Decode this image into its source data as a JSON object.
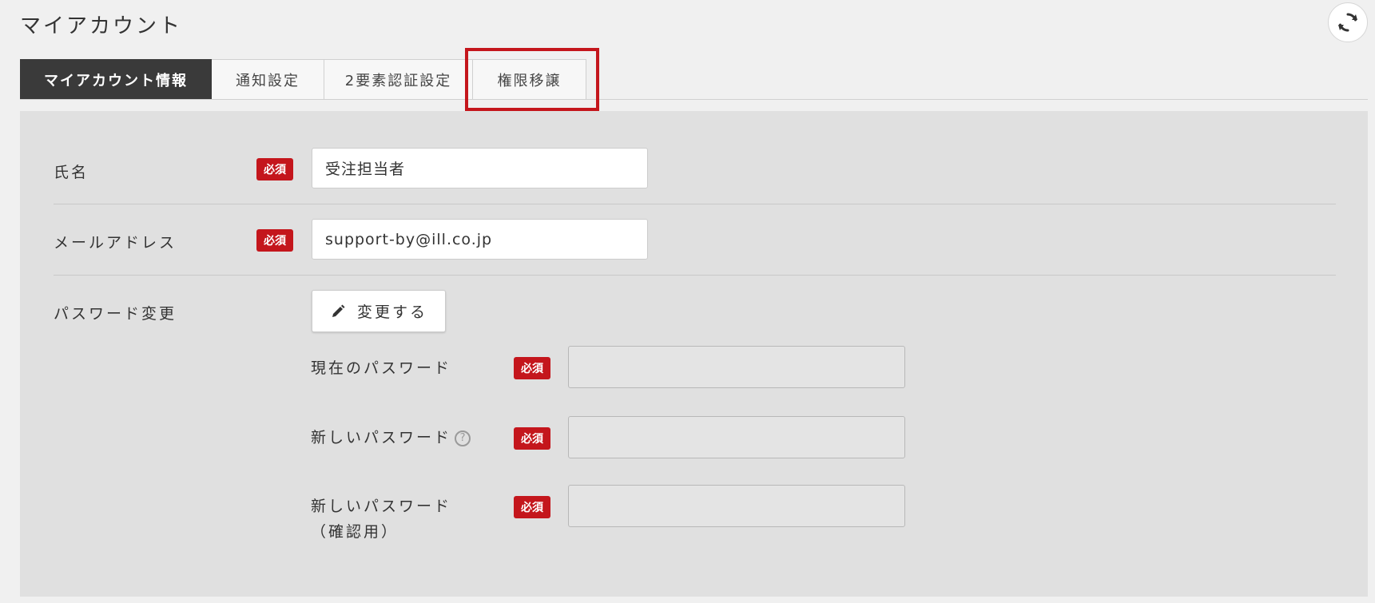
{
  "header": {
    "title": "マイアカウント",
    "refresh_icon": "refresh-icon"
  },
  "tabs": [
    {
      "label": "マイアカウント情報",
      "active": true
    },
    {
      "label": "通知設定",
      "active": false
    },
    {
      "label": "2要素認証設定",
      "active": false
    },
    {
      "label": "権限移譲",
      "active": false,
      "highlighted": true
    }
  ],
  "form": {
    "required_badge": "必須",
    "name": {
      "label": "氏名",
      "value": "受注担当者"
    },
    "email": {
      "label": "メールアドレス",
      "value": "support-by@ill.co.jp"
    },
    "password": {
      "label": "パスワード変更",
      "change_button": "変更する",
      "change_icon": "pencil-icon",
      "current": {
        "label": "現在のパスワード",
        "value": ""
      },
      "new": {
        "label": "新しいパスワード",
        "help_icon": "question-icon",
        "help_glyph": "?",
        "value": ""
      },
      "confirm": {
        "label_line1": "新しいパスワード",
        "label_line2": "（確認用）",
        "value": ""
      }
    }
  },
  "colors": {
    "required": "#c4161c",
    "active_tab": "#3a3a3a",
    "highlight": "#c4161c",
    "panel": "#e0e0e0"
  }
}
